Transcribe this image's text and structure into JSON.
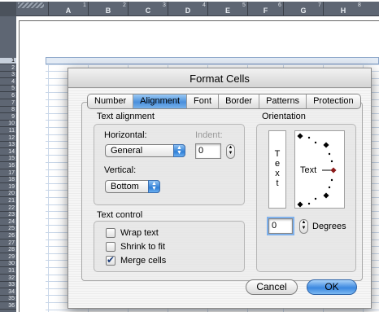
{
  "spreadsheet": {
    "columns": [
      "A",
      "B",
      "C",
      "D",
      "E",
      "F",
      "G",
      "H"
    ],
    "ruler_marks": [
      "1",
      "2",
      "3",
      "4",
      "5",
      "6",
      "7",
      "8"
    ],
    "rows": [
      "1",
      "2",
      "3",
      "4",
      "5",
      "6",
      "7",
      "8",
      "9",
      "10",
      "11",
      "12",
      "13",
      "14",
      "15",
      "16",
      "17",
      "18",
      "19",
      "20",
      "21",
      "22",
      "23",
      "24",
      "25",
      "26",
      "27",
      "28",
      "29",
      "30",
      "31",
      "32",
      "33",
      "34",
      "35",
      "36"
    ],
    "selected_row": "1"
  },
  "dialog": {
    "title": "Format Cells",
    "tabs": [
      {
        "label": "Number",
        "active": false
      },
      {
        "label": "Alignment",
        "active": true
      },
      {
        "label": "Font",
        "active": false
      },
      {
        "label": "Border",
        "active": false
      },
      {
        "label": "Patterns",
        "active": false
      },
      {
        "label": "Protection",
        "active": false
      }
    ],
    "text_alignment": {
      "group_label": "Text alignment",
      "horizontal_label": "Horizontal:",
      "horizontal_value": "General",
      "indent_label": "Indent:",
      "indent_value": "0",
      "vertical_label": "Vertical:",
      "vertical_value": "Bottom"
    },
    "text_control": {
      "group_label": "Text control",
      "options": [
        {
          "label": "Wrap text",
          "checked": false
        },
        {
          "label": "Shrink to fit",
          "checked": false
        },
        {
          "label": "Merge cells",
          "checked": true
        }
      ]
    },
    "orientation": {
      "group_label": "Orientation",
      "vertical_text": "T\ne\nx\nt",
      "dial_text": "Text",
      "degrees_value": "0",
      "degrees_label": "Degrees"
    },
    "buttons": {
      "cancel": "Cancel",
      "ok": "OK"
    }
  }
}
